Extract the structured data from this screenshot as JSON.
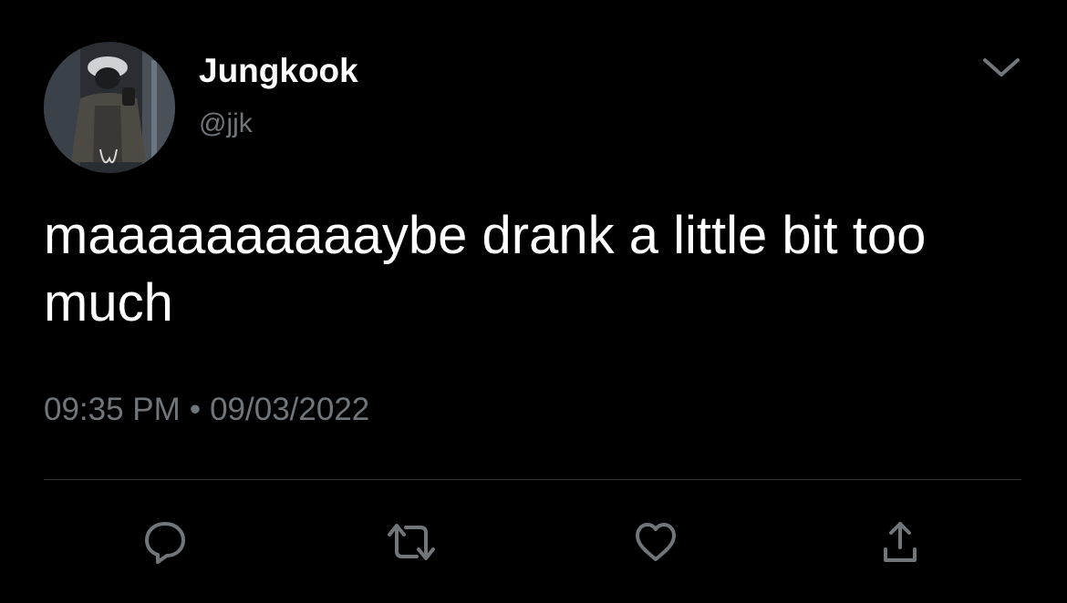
{
  "author": {
    "display_name": "Jungkook",
    "handle": "@jjk"
  },
  "tweet": {
    "text": "maaaaaaaaaaybe drank a little bit too much",
    "time": "09:35 PM",
    "separator": "•",
    "date": "09/03/2022"
  },
  "icons": {
    "menu": "chevron-down-icon",
    "reply": "speech-bubble-icon",
    "retweet": "retweet-arrows-icon",
    "like": "heart-icon",
    "share": "share-upload-icon"
  },
  "colors": {
    "background": "#000000",
    "primary_text": "#ffffff",
    "secondary_text": "#71767b",
    "divider": "#2f3336",
    "icon": "#71767b"
  }
}
